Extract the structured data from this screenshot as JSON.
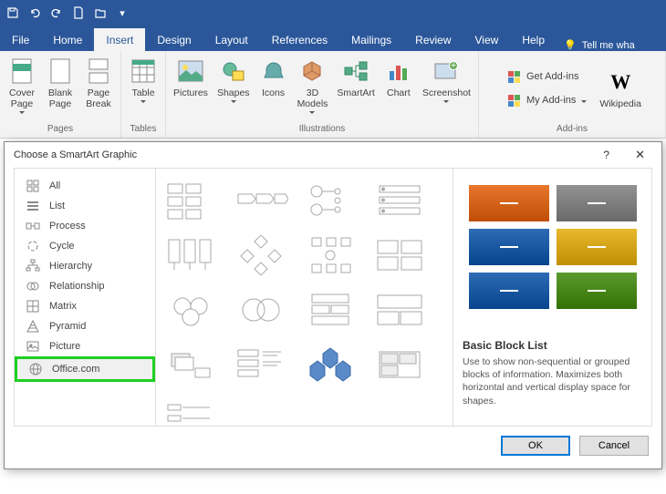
{
  "qat": [
    "save",
    "undo",
    "redo",
    "new",
    "open",
    "more"
  ],
  "tabs": {
    "file": "File",
    "home": "Home",
    "insert": "Insert",
    "design": "Design",
    "layout": "Layout",
    "references": "References",
    "mailings": "Mailings",
    "review": "Review",
    "view": "View",
    "help": "Help",
    "tellme": "Tell me wha"
  },
  "ribbon": {
    "pages": {
      "label": "Pages",
      "cover": "Cover\nPage",
      "blank": "Blank\nPage",
      "pageBreak": "Page\nBreak"
    },
    "tables": {
      "label": "Tables",
      "table": "Table"
    },
    "illustrations": {
      "label": "Illustrations",
      "pictures": "Pictures",
      "shapes": "Shapes",
      "icons": "Icons",
      "models": "3D\nModels",
      "smartart": "SmartArt",
      "chart": "Chart",
      "screenshot": "Screenshot"
    },
    "addins": {
      "label": "Add-ins",
      "get": "Get Add-ins",
      "my": "My Add-ins",
      "wiki": "Wikipedia"
    }
  },
  "dialog": {
    "title": "Choose a SmartArt Graphic",
    "categories": [
      {
        "label": "All",
        "icon": "all"
      },
      {
        "label": "List",
        "icon": "list"
      },
      {
        "label": "Process",
        "icon": "process"
      },
      {
        "label": "Cycle",
        "icon": "cycle"
      },
      {
        "label": "Hierarchy",
        "icon": "hierarchy"
      },
      {
        "label": "Relationship",
        "icon": "relationship"
      },
      {
        "label": "Matrix",
        "icon": "matrix"
      },
      {
        "label": "Pyramid",
        "icon": "pyramid"
      },
      {
        "label": "Picture",
        "icon": "picture"
      },
      {
        "label": "Office.com",
        "icon": "globe",
        "highlight": true
      }
    ],
    "preview": {
      "title": "Basic Block List",
      "desc": "Use to show non-sequential or grouped blocks of information. Maximizes both horizontal and vertical display space for shapes.",
      "colors": [
        "#e8762d",
        "#929292",
        "#2e6db5",
        "#e8b82d",
        "#2e6db5",
        "#5c9a2e"
      ]
    },
    "ok": "OK",
    "cancel": "Cancel"
  }
}
